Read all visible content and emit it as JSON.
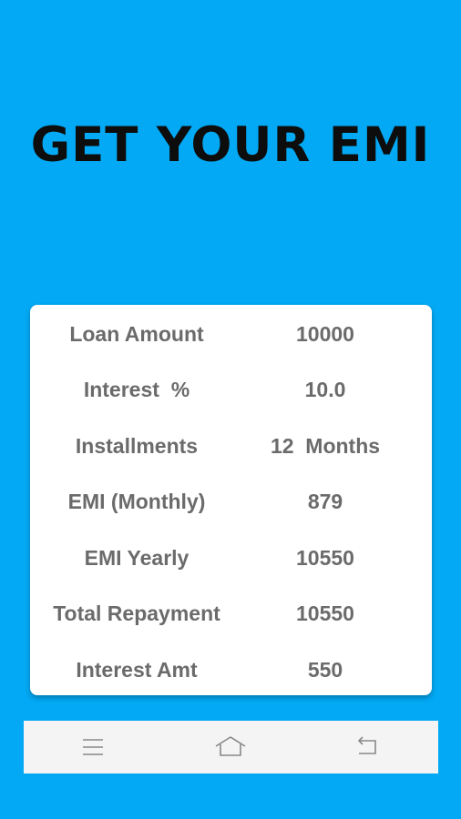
{
  "header": {
    "title": "GET YOUR EMI"
  },
  "results": {
    "rows": [
      {
        "label": "Loan Amount",
        "value": "10000"
      },
      {
        "label": "Interest  %",
        "value": "10.0"
      },
      {
        "label": "Installments",
        "value": "12  Months"
      },
      {
        "label": "EMI (Monthly)",
        "value": "879"
      },
      {
        "label": "EMI Yearly",
        "value": "10550"
      },
      {
        "label": "Total Repayment",
        "value": "10550"
      },
      {
        "label": "Interest Amt",
        "value": "550"
      }
    ]
  },
  "navbar": {
    "items": [
      {
        "icon": "menu-icon"
      },
      {
        "icon": "home-icon"
      },
      {
        "icon": "back-icon"
      }
    ]
  },
  "colors": {
    "background": "#03a9f4",
    "card": "#ffffff",
    "text": "#6b6b6b",
    "title": "#0d0d0d",
    "navbar": "#f4f4f4"
  }
}
